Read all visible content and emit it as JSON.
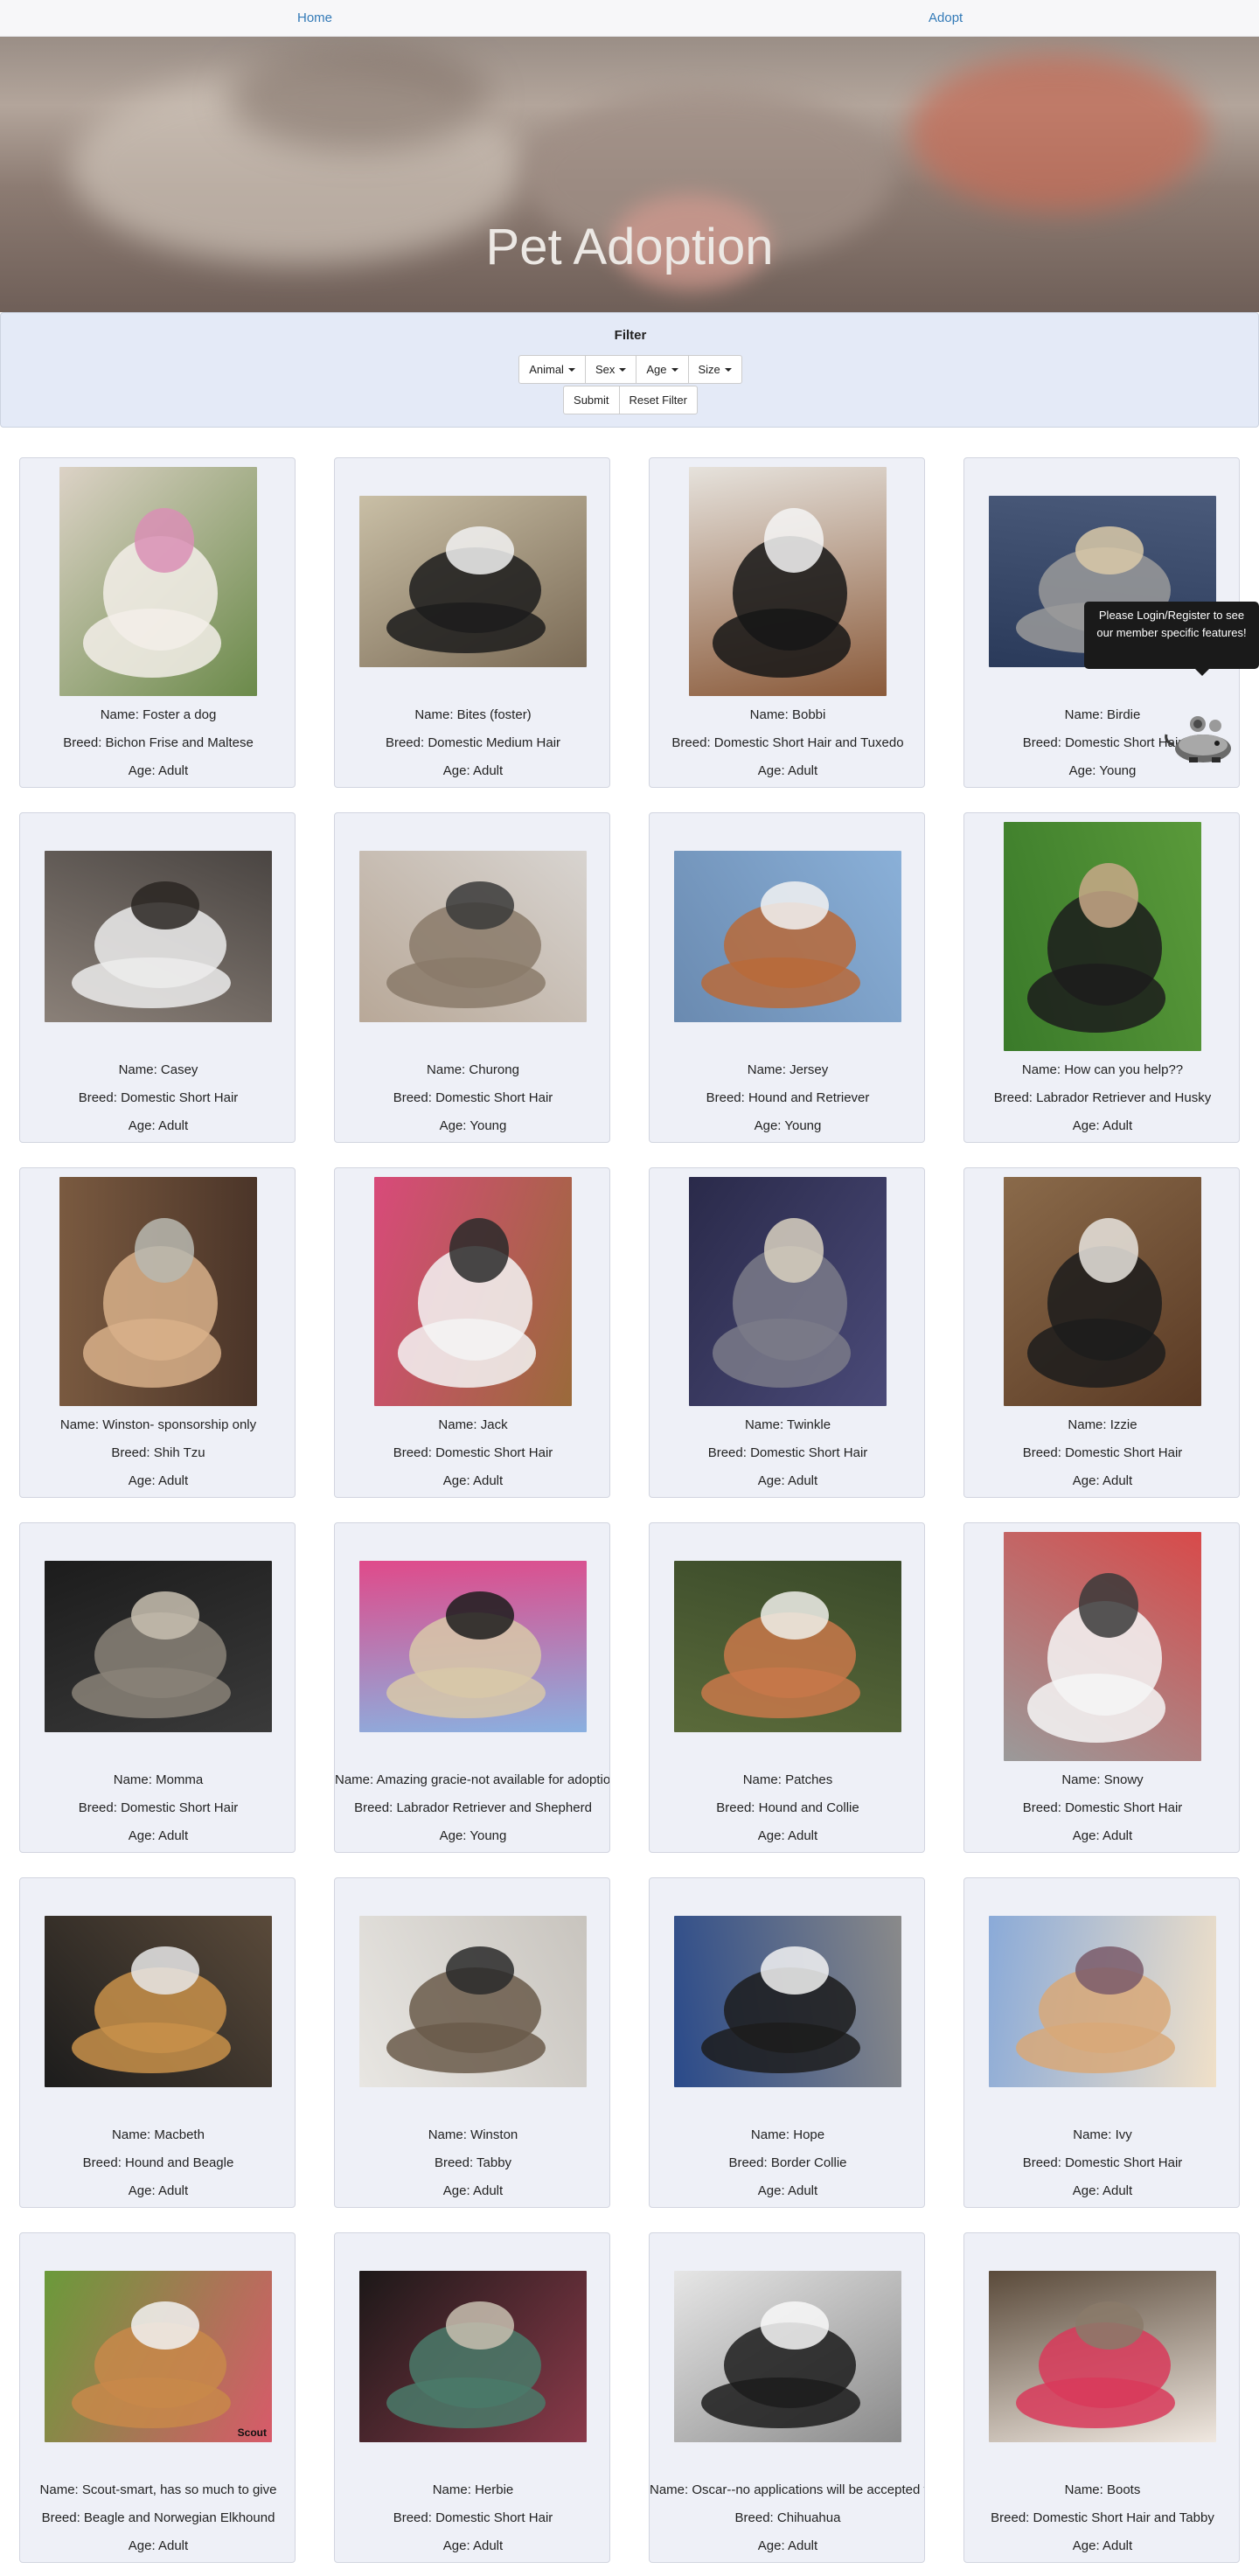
{
  "nav": {
    "home": "Home",
    "adopt": "Adopt"
  },
  "hero": {
    "title": "Pet Adoption"
  },
  "filter": {
    "title": "Filter",
    "dropdowns": [
      "Animal",
      "Sex",
      "Age",
      "Size"
    ],
    "submit": "Submit",
    "reset": "Reset Filter"
  },
  "tooltip": {
    "text": "Please Login/Register to see our member specific features!"
  },
  "mascot_icon": "robot-mouse-icon",
  "pets": [
    {
      "name": "Name: Foster a dog",
      "breed": "Breed: Bichon Frise and Maltese",
      "age": "Age: Adult",
      "colors": [
        "#dcd2c6",
        "#f3efe9",
        "#d98fb5",
        "#6b8a4a"
      ],
      "tall": true
    },
    {
      "name": "Name: Bites (foster)",
      "breed": "Breed: Domestic Medium Hair",
      "age": "Age: Adult",
      "colors": [
        "#c9bfa6",
        "#1c1c1c",
        "#f1f1f1",
        "#7a6a55"
      ],
      "tall": false
    },
    {
      "name": "Name: Bobbi",
      "breed": "Breed: Domestic Short Hair and Tuxedo",
      "age": "Age: Adult",
      "colors": [
        "#e6e2dc",
        "#161616",
        "#f5f5f5",
        "#8a5a3a"
      ],
      "tall": true
    },
    {
      "name": "Name: Birdie",
      "breed": "Breed: Domestic Short Hair",
      "age": "Age: Young",
      "colors": [
        "#4a5a7a",
        "#9a9a9a",
        "#d9c9a8",
        "#2a3a5a"
      ],
      "tall": false
    },
    {
      "name": "Name: Casey",
      "breed": "Breed: Domestic Short Hair",
      "age": "Age: Adult",
      "colors": [
        "#4a4542",
        "#ececec",
        "#2a2622",
        "#8a8078"
      ],
      "tall": false
    },
    {
      "name": "Name: Churong",
      "breed": "Breed: Domestic Short Hair",
      "age": "Age: Young",
      "colors": [
        "#d8d4d0",
        "#8a7a6a",
        "#3a3a3a",
        "#b8a898"
      ],
      "tall": false
    },
    {
      "name": "Name: Jersey",
      "breed": "Breed: Hound and Retriever",
      "age": "Age: Young",
      "colors": [
        "#8ab0d8",
        "#b86a3a",
        "#f2f2f2",
        "#6a8ab0"
      ],
      "tall": false
    },
    {
      "name": "Name: How can you help??",
      "breed": "Breed: Labrador Retriever and Husky",
      "age": "Age: Adult",
      "colors": [
        "#5a9a3a",
        "#1c1c1c",
        "#c8a888",
        "#3a7a2a"
      ],
      "tall": true
    },
    {
      "name": "Name: Winston- sponsorship only",
      "breed": "Breed: Shih Tzu",
      "age": "Age: Adult",
      "colors": [
        "#4a3428",
        "#d8b08a",
        "#b8b8b0",
        "#7a5a40"
      ],
      "tall": true
    },
    {
      "name": "Name: Jack",
      "breed": "Breed: Domestic Short Hair",
      "age": "Age: Adult",
      "colors": [
        "#9a6a3a",
        "#f4f4f4",
        "#2a2a2a",
        "#d84a7a"
      ],
      "tall": true
    },
    {
      "name": "Name: Twinkle",
      "breed": "Breed: Domestic Short Hair",
      "age": "Age: Adult",
      "colors": [
        "#4a4a78",
        "#7a7a88",
        "#d8d0c0",
        "#2a2a4a"
      ],
      "tall": true
    },
    {
      "name": "Name: Izzie",
      "breed": "Breed: Domestic Short Hair",
      "age": "Age: Adult",
      "colors": [
        "#5a3a24",
        "#1c1c1c",
        "#e8e4de",
        "#8a6a4a"
      ],
      "tall": true
    },
    {
      "name": "Name: Momma",
      "breed": "Breed: Domestic Short Hair",
      "age": "Age: Adult",
      "colors": [
        "#3a3a3a",
        "#8a8278",
        "#c8c0b0",
        "#1c1c1c"
      ],
      "tall": false
    },
    {
      "name": "Name: Amazing gracie-not available for adoption",
      "breed": "Breed: Labrador Retriever and Shepherd",
      "age": "Age: Young",
      "colors": [
        "#8ab0e0",
        "#d8c8a8",
        "#1c1c1c",
        "#e04a8a"
      ],
      "tall": false
    },
    {
      "name": "Name: Patches",
      "breed": "Breed: Hound and Collie",
      "age": "Age: Adult",
      "colors": [
        "#5a6a3a",
        "#c8784a",
        "#f0f0ea",
        "#3a4a2a"
      ],
      "tall": false
    },
    {
      "name": "Name: Snowy",
      "breed": "Breed: Domestic Short Hair",
      "age": "Age: Adult",
      "colors": [
        "#9a9a9a",
        "#f6f6f6",
        "#3a3a3a",
        "#d84a4a"
      ],
      "tall": true
    },
    {
      "name": "Name: Macbeth",
      "breed": "Breed: Hound and Beagle",
      "age": "Age: Adult",
      "colors": [
        "#1c1c1c",
        "#c8904a",
        "#e8e8e8",
        "#5a4a3a"
      ],
      "tall": false
    },
    {
      "name": "Name: Winston",
      "breed": "Breed: Tabby",
      "age": "Age: Adult",
      "colors": [
        "#e8e6e2",
        "#6a5a4a",
        "#2a2a2a",
        "#c8c4be"
      ],
      "tall": false
    },
    {
      "name": "Name: Hope",
      "breed": "Breed: Border Collie",
      "age": "Age: Adult",
      "colors": [
        "#2a4a8a",
        "#1c1c1c",
        "#f2f2f2",
        "#8a8a8a"
      ],
      "tall": false
    },
    {
      "name": "Name: Ivy",
      "breed": "Breed: Domestic Short Hair",
      "age": "Age: Adult",
      "colors": [
        "#8aaad8",
        "#d8a878",
        "#7a5a6a",
        "#f0e0c8"
      ],
      "tall": false
    },
    {
      "name": "Name: Scout-smart, has so much to give",
      "breed": "Breed: Beagle and Norwegian Elkhound",
      "age": "Age: Adult",
      "colors": [
        "#6a9a3a",
        "#c8884a",
        "#f2f2f2",
        "#d85a6a"
      ],
      "tall": false,
      "caption": "Scout"
    },
    {
      "name": "Name: Herbie",
      "breed": "Breed: Domestic Short Hair",
      "age": "Age: Adult",
      "colors": [
        "#1c1818",
        "#4a7a6a",
        "#c8c0b0",
        "#8a3a4a"
      ],
      "tall": false
    },
    {
      "name": "Name: Oscar--no applications will be accepted for o",
      "breed": "Breed: Chihuahua",
      "age": "Age: Adult",
      "colors": [
        "#e6e6e6",
        "#1c1c1c",
        "#f8f8f8",
        "#8a8a8a"
      ],
      "tall": false
    },
    {
      "name": "Name: Boots",
      "breed": "Breed: Domestic Short Hair and Tabby",
      "age": "Age: Adult",
      "colors": [
        "#5a4a3a",
        "#d83a5a",
        "#8a7a6a",
        "#f0e8e0"
      ],
      "tall": false
    }
  ]
}
